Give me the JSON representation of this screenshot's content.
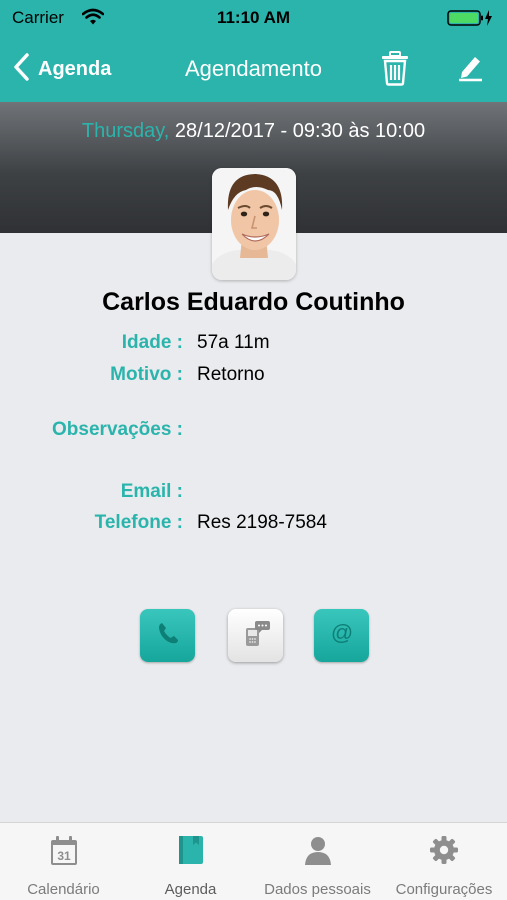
{
  "status_bar": {
    "carrier": "Carrier",
    "time": "11:10 AM"
  },
  "nav": {
    "back_label": "Agenda",
    "title": "Agendamento"
  },
  "appointment": {
    "weekday": "Thursday,",
    "datetime": "28/12/2017 - 09:30 às 10:00"
  },
  "patient": {
    "name": "Carlos Eduardo Coutinho"
  },
  "fields": {
    "idade": {
      "label": "Idade :",
      "value": "57a 11m"
    },
    "motivo": {
      "label": "Motivo :",
      "value": "Retorno"
    },
    "observacoes": {
      "label": "Observações :",
      "value": ""
    },
    "email": {
      "label": "Email :",
      "value": ""
    },
    "telefone": {
      "label": "Telefone :",
      "value": "Res 2198-7584"
    }
  },
  "tabs": [
    {
      "label": "Calendário",
      "icon": "calendar-icon",
      "calendar_day": "31",
      "active": false
    },
    {
      "label": "Agenda",
      "icon": "agenda-book-icon",
      "active": true
    },
    {
      "label": "Dados pessoais",
      "icon": "person-icon",
      "active": false
    },
    {
      "label": "Configurações",
      "icon": "gear-icon",
      "active": false
    }
  ],
  "colors": {
    "accent": "#2bb4ac",
    "header_dark": "#3e4144",
    "background": "#e9ebee",
    "tab_inactive": "#7b7b7b"
  }
}
